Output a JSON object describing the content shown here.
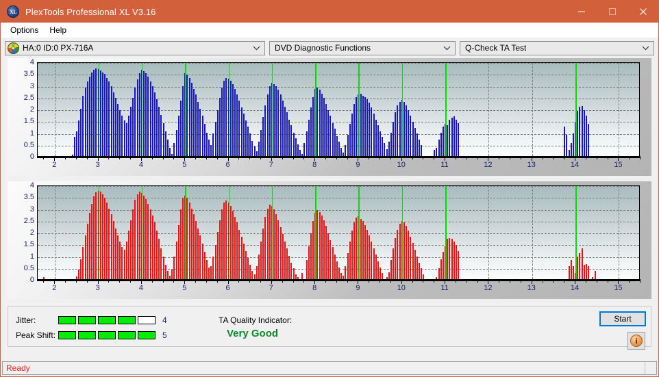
{
  "window": {
    "title": "PlexTools Professional XL V3.16",
    "app_icon": "xl-disc-icon",
    "accent_color": "#d2603a",
    "controls": {
      "minimize": "minimize-icon",
      "maximize": "maximize-icon",
      "close": "close-icon"
    }
  },
  "menubar": {
    "items": [
      {
        "label": "Options"
      },
      {
        "label": "Help"
      }
    ]
  },
  "toolbar": {
    "drive": {
      "value": "HA:0 ID:0  PX-716A",
      "icon": "optical-disc-icon"
    },
    "function": {
      "value": "DVD Diagnostic Functions"
    },
    "test": {
      "value": "Q-Check TA Test"
    }
  },
  "charts": [
    {
      "name": "jitter-chart",
      "color": "#1515d0",
      "y_ticks": [
        "4",
        "3.5",
        "3",
        "2.5",
        "2",
        "1.5",
        "1",
        "0.5",
        "0"
      ],
      "x_ticks": [
        "2",
        "3",
        "4",
        "5",
        "6",
        "7",
        "8",
        "9",
        "10",
        "11",
        "12",
        "13",
        "14",
        "15"
      ]
    },
    {
      "name": "peak-shift-chart",
      "color": "#fc0d0d",
      "y_ticks": [
        "4",
        "3.5",
        "3",
        "2.5",
        "2",
        "1.5",
        "1",
        "0.5",
        "0"
      ],
      "x_ticks": [
        "2",
        "3",
        "4",
        "5",
        "6",
        "7",
        "8",
        "9",
        "10",
        "11",
        "12",
        "13",
        "14",
        "15"
      ]
    }
  ],
  "chart_data": [
    {
      "type": "bar",
      "name": "jitter-chart",
      "title": "",
      "xlabel": "",
      "ylabel": "",
      "color": "#1515d0",
      "xlim": [
        1.6,
        15.5
      ],
      "ylim": [
        0,
        4
      ],
      "grid": true,
      "marker_color": "#00e000",
      "markers": [
        3,
        4,
        5,
        6,
        7,
        8,
        9,
        10,
        11,
        14
      ],
      "x": [
        2.4,
        2.45,
        2.5,
        2.55,
        2.6,
        2.65,
        2.7,
        2.75,
        2.8,
        2.85,
        2.9,
        2.95,
        3.0,
        3.05,
        3.1,
        3.15,
        3.2,
        3.25,
        3.3,
        3.35,
        3.4,
        3.45,
        3.5,
        3.55,
        3.6,
        3.65,
        3.7,
        3.75,
        3.8,
        3.85,
        3.9,
        3.95,
        4.0,
        4.05,
        4.1,
        4.15,
        4.2,
        4.25,
        4.3,
        4.35,
        4.4,
        4.45,
        4.5,
        4.55,
        4.6,
        4.65,
        4.7,
        4.75,
        4.8,
        4.85,
        4.9,
        4.95,
        5.0,
        5.05,
        5.1,
        5.15,
        5.2,
        5.25,
        5.3,
        5.35,
        5.4,
        5.45,
        5.5,
        5.55,
        5.6,
        5.65,
        5.7,
        5.75,
        5.8,
        5.85,
        5.9,
        5.95,
        6.0,
        6.05,
        6.1,
        6.15,
        6.2,
        6.25,
        6.3,
        6.35,
        6.4,
        6.45,
        6.5,
        6.55,
        6.6,
        6.65,
        6.7,
        6.75,
        6.8,
        6.85,
        6.9,
        6.95,
        7.0,
        7.05,
        7.1,
        7.15,
        7.2,
        7.25,
        7.3,
        7.35,
        7.4,
        7.45,
        7.5,
        7.55,
        7.6,
        7.65,
        7.7,
        7.75,
        7.8,
        7.85,
        7.9,
        7.95,
        8.0,
        8.05,
        8.1,
        8.15,
        8.2,
        8.25,
        8.3,
        8.35,
        8.4,
        8.45,
        8.5,
        8.55,
        8.6,
        8.65,
        8.7,
        8.75,
        8.8,
        8.85,
        8.9,
        8.95,
        9.0,
        9.05,
        9.1,
        9.15,
        9.2,
        9.25,
        9.3,
        9.35,
        9.4,
        9.45,
        9.5,
        9.55,
        9.6,
        9.65,
        9.7,
        9.75,
        9.8,
        9.85,
        9.9,
        9.95,
        10.0,
        10.05,
        10.1,
        10.15,
        10.2,
        10.25,
        10.3,
        10.35,
        10.4,
        10.45,
        10.75,
        10.8,
        10.85,
        10.9,
        10.95,
        11.0,
        11.05,
        11.1,
        11.15,
        11.2,
        11.25,
        11.3,
        13.75,
        13.8,
        13.85,
        13.9,
        13.95,
        14.0,
        14.05,
        14.1,
        14.15,
        14.2,
        14.25,
        14.3
      ],
      "values": [
        0.05,
        0.8,
        1.05,
        1.5,
        2.0,
        2.55,
        2.9,
        3.15,
        3.35,
        3.55,
        3.65,
        3.7,
        3.68,
        3.62,
        3.55,
        3.48,
        3.3,
        3.15,
        2.95,
        2.7,
        2.45,
        2.2,
        1.95,
        1.7,
        1.5,
        1.4,
        1.7,
        2.1,
        2.45,
        2.9,
        3.25,
        3.5,
        3.65,
        3.6,
        3.5,
        3.35,
        3.15,
        2.95,
        2.7,
        2.4,
        2.1,
        1.75,
        1.4,
        1.05,
        0.7,
        0.35,
        0.1,
        0.55,
        1.1,
        1.7,
        2.35,
        2.95,
        3.5,
        3.45,
        3.3,
        3.1,
        2.85,
        2.6,
        2.3,
        2.0,
        1.7,
        1.35,
        1.0,
        0.7,
        0.45,
        0.95,
        1.45,
        1.95,
        2.45,
        2.9,
        3.2,
        3.3,
        3.28,
        3.2,
        3.05,
        2.85,
        2.6,
        2.35,
        2.05,
        1.8,
        1.5,
        1.25,
        0.95,
        0.65,
        0.4,
        0.2,
        0.6,
        1.1,
        1.65,
        2.15,
        2.6,
        2.95,
        3.1,
        3.05,
        2.95,
        2.8,
        2.6,
        2.35,
        2.1,
        1.85,
        1.55,
        1.3,
        1.0,
        0.75,
        0.5,
        0.25,
        0.1,
        0.55,
        1.05,
        1.55,
        2.05,
        2.5,
        2.85,
        2.9,
        2.8,
        2.65,
        2.45,
        2.2,
        1.95,
        1.7,
        1.4,
        1.15,
        0.85,
        0.6,
        0.35,
        0.15,
        0.45,
        0.9,
        1.35,
        1.8,
        2.2,
        2.5,
        2.62,
        2.65,
        2.55,
        2.5,
        2.4,
        2.25,
        2.05,
        1.8,
        1.55,
        1.3,
        1.05,
        0.8,
        0.55,
        0.3,
        0.6,
        1.0,
        1.45,
        1.85,
        2.15,
        2.3,
        2.38,
        2.3,
        2.15,
        1.95,
        1.7,
        1.45,
        1.2,
        0.95,
        0.7,
        0.45,
        0.25,
        0.35,
        0.7,
        1.0,
        1.25,
        1.35,
        1.3,
        1.55,
        1.62,
        1.68,
        1.55,
        1.4,
        1.25,
        0.9,
        0.25,
        0.55,
        0.95,
        1.45,
        1.9,
        2.1,
        2.12,
        1.95,
        1.7,
        1.35,
        1.0,
        0.65,
        0.3
      ]
    },
    {
      "type": "bar",
      "name": "peak-shift-chart",
      "title": "",
      "xlabel": "",
      "ylabel": "",
      "color": "#fc0d0d",
      "xlim": [
        1.6,
        15.5
      ],
      "ylim": [
        0,
        4
      ],
      "grid": true,
      "marker_color": "#00e000",
      "markers": [
        3,
        4,
        5,
        6,
        7,
        8,
        9,
        10,
        11,
        14
      ],
      "x": [
        1.75,
        2.5,
        2.55,
        2.6,
        2.65,
        2.7,
        2.75,
        2.8,
        2.85,
        2.9,
        2.95,
        3.0,
        3.05,
        3.1,
        3.15,
        3.2,
        3.25,
        3.3,
        3.35,
        3.4,
        3.45,
        3.5,
        3.55,
        3.6,
        3.65,
        3.7,
        3.75,
        3.8,
        3.85,
        3.9,
        3.95,
        4.0,
        4.05,
        4.1,
        4.15,
        4.2,
        4.25,
        4.3,
        4.35,
        4.4,
        4.45,
        4.5,
        4.55,
        4.6,
        4.65,
        4.7,
        4.75,
        4.8,
        4.85,
        4.9,
        4.95,
        5.0,
        5.05,
        5.1,
        5.15,
        5.2,
        5.25,
        5.3,
        5.35,
        5.4,
        5.45,
        5.5,
        5.55,
        5.6,
        5.65,
        5.7,
        5.75,
        5.8,
        5.85,
        5.9,
        5.95,
        6.0,
        6.05,
        6.1,
        6.15,
        6.2,
        6.25,
        6.3,
        6.35,
        6.4,
        6.45,
        6.5,
        6.55,
        6.6,
        6.65,
        6.7,
        6.75,
        6.8,
        6.85,
        6.9,
        6.95,
        7.0,
        7.05,
        7.1,
        7.15,
        7.2,
        7.25,
        7.3,
        7.35,
        7.4,
        7.45,
        7.5,
        7.55,
        7.6,
        7.7,
        7.8,
        7.85,
        7.9,
        7.95,
        8.0,
        8.05,
        8.1,
        8.15,
        8.2,
        8.25,
        8.3,
        8.35,
        8.4,
        8.45,
        8.5,
        8.55,
        8.6,
        8.65,
        8.7,
        8.75,
        8.8,
        8.85,
        8.9,
        8.95,
        9.0,
        9.05,
        9.1,
        9.15,
        9.2,
        9.25,
        9.3,
        9.35,
        9.4,
        9.45,
        9.5,
        9.55,
        9.65,
        9.7,
        9.75,
        9.8,
        9.85,
        9.9,
        9.95,
        10.0,
        10.05,
        10.1,
        10.15,
        10.2,
        10.25,
        10.3,
        10.35,
        10.4,
        10.45,
        10.5,
        10.8,
        10.85,
        10.9,
        10.95,
        11.0,
        11.05,
        11.1,
        11.15,
        11.2,
        11.25,
        11.3,
        13.85,
        13.9,
        13.95,
        14.0,
        14.05,
        14.1,
        14.15,
        14.2,
        14.25,
        14.3,
        14.4,
        14.45
      ],
      "values": [
        0.1,
        0.12,
        0.4,
        0.85,
        1.35,
        1.85,
        2.35,
        2.8,
        3.2,
        3.5,
        3.68,
        3.75,
        3.72,
        3.6,
        3.45,
        3.25,
        3.0,
        2.75,
        2.45,
        2.15,
        1.85,
        1.6,
        1.35,
        1.25,
        1.6,
        2.05,
        2.5,
        2.95,
        3.35,
        3.6,
        3.7,
        3.66,
        3.55,
        3.4,
        3.2,
        2.95,
        2.7,
        2.4,
        2.05,
        1.7,
        1.3,
        0.95,
        0.6,
        0.35,
        0.15,
        0.4,
        0.95,
        1.6,
        2.3,
        2.95,
        3.45,
        3.55,
        3.45,
        3.25,
        3.0,
        2.75,
        2.45,
        2.15,
        1.85,
        1.5,
        1.15,
        0.8,
        0.5,
        0.55,
        0.95,
        1.45,
        2.0,
        2.5,
        2.95,
        3.25,
        3.32,
        3.25,
        3.1,
        2.9,
        2.65,
        2.4,
        2.1,
        1.8,
        1.5,
        1.2,
        0.9,
        0.6,
        0.35,
        0.2,
        0.55,
        1.05,
        1.6,
        2.15,
        2.65,
        3.0,
        3.15,
        3.1,
        2.95,
        2.75,
        2.5,
        2.2,
        1.9,
        1.6,
        1.3,
        1.0,
        0.7,
        0.45,
        0.2,
        0.1,
        0.25,
        0.8,
        1.4,
        1.95,
        2.45,
        2.8,
        2.92,
        2.85,
        2.7,
        2.5,
        2.25,
        1.95,
        1.65,
        1.35,
        1.05,
        0.75,
        0.5,
        0.25,
        0.15,
        0.55,
        1.1,
        1.6,
        2.05,
        2.4,
        2.6,
        2.66,
        2.55,
        2.45,
        2.3,
        2.1,
        1.85,
        1.6,
        1.3,
        1.05,
        0.75,
        0.5,
        0.25,
        0.1,
        0.3,
        0.8,
        1.3,
        1.75,
        2.1,
        2.35,
        2.45,
        2.42,
        2.25,
        2.05,
        1.8,
        1.55,
        1.25,
        0.95,
        0.7,
        0.45,
        0.2,
        0.1,
        0.45,
        0.85,
        1.15,
        1.4,
        1.7,
        1.75,
        1.72,
        1.6,
        1.45,
        1.2,
        0.55,
        0.8,
        0.55,
        0.25,
        0.95,
        1.1,
        1.3,
        0.6,
        0.65,
        0.55,
        0.1,
        0.35
      ]
    }
  ],
  "results": {
    "jitter": {
      "label": "Jitter:",
      "filled": 4,
      "total": 5,
      "value": "4"
    },
    "peak_shift": {
      "label": "Peak Shift:",
      "filled": 5,
      "total": 5,
      "value": "5"
    },
    "ta_quality": {
      "label": "TA Quality Indicator:",
      "value": "Very Good",
      "color": "#0a8a2a"
    },
    "start_button": "Start",
    "info_button": "info-icon"
  },
  "statusbar": {
    "text": "Ready",
    "color": "#ff2020"
  }
}
